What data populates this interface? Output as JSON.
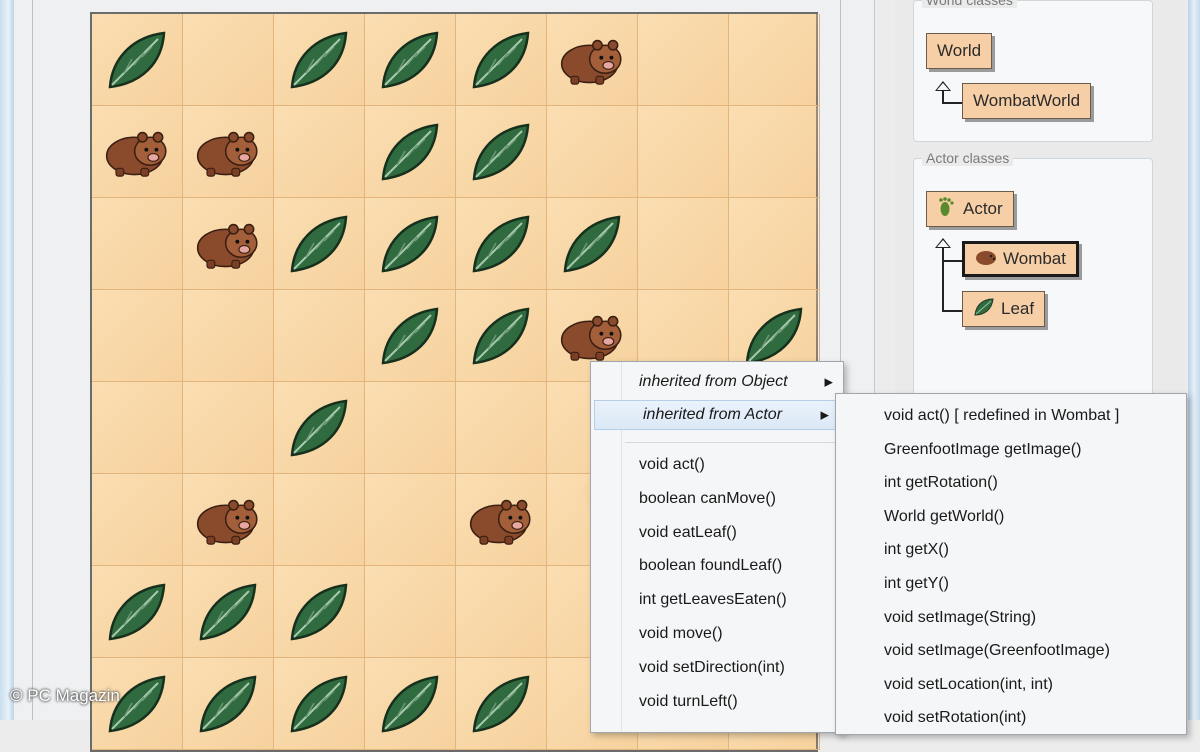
{
  "world": {
    "rows": [
      [
        "leaf",
        "",
        "leaf",
        "leaf",
        "leaf",
        "wombat",
        "",
        ""
      ],
      [
        "wombat",
        "wombat",
        "",
        "leaf",
        "leaf",
        "",
        "",
        ""
      ],
      [
        "",
        "wombat",
        "leaf",
        "leaf",
        "leaf",
        "leaf",
        "",
        ""
      ],
      [
        "",
        "",
        "",
        "leaf",
        "leaf",
        "wombat",
        "",
        "leaf"
      ],
      [
        "",
        "",
        "leaf",
        "",
        "",
        "",
        "",
        ""
      ],
      [
        "",
        "wombat",
        "",
        "",
        "wombat",
        "",
        "",
        ""
      ],
      [
        "leaf",
        "leaf",
        "leaf",
        "",
        "",
        "",
        "",
        ""
      ],
      [
        "leaf",
        "leaf",
        "leaf",
        "leaf",
        "leaf",
        "",
        "",
        ""
      ]
    ]
  },
  "class_panel": {
    "world_group_title": "World classes",
    "world_class": "World",
    "world_subclass": "WombatWorld",
    "actor_group_title": "Actor classes",
    "actor_class": "Actor",
    "actor_subclasses": [
      "Wombat",
      "Leaf"
    ],
    "selected_class": "Wombat"
  },
  "context_menu": {
    "inherited_object": "inherited from Object",
    "inherited_actor": "inherited from Actor",
    "methods": [
      "void act()",
      "boolean canMove()",
      "void eatLeaf()",
      "boolean foundLeaf()",
      "int getLeavesEaten()",
      "void move()",
      "void setDirection(int)",
      "void turnLeft()"
    ]
  },
  "submenu": {
    "items": [
      "void act()   [ redefined in Wombat ]",
      "GreenfootImage getImage()",
      "int getRotation()",
      "World getWorld()",
      "int getX()",
      "int getY()",
      "void setImage(String)",
      "void setImage(GreenfootImage)",
      "void setLocation(int, int)",
      "void setRotation(int)"
    ]
  },
  "watermark": "© PC Magazin",
  "colors": {
    "world_background": "#f7d39f",
    "class_box": "#f7cfa6",
    "leaf": "#2f6b3e",
    "wombat": "#8a4a2c",
    "menu_highlight": "#dbe8f6"
  }
}
